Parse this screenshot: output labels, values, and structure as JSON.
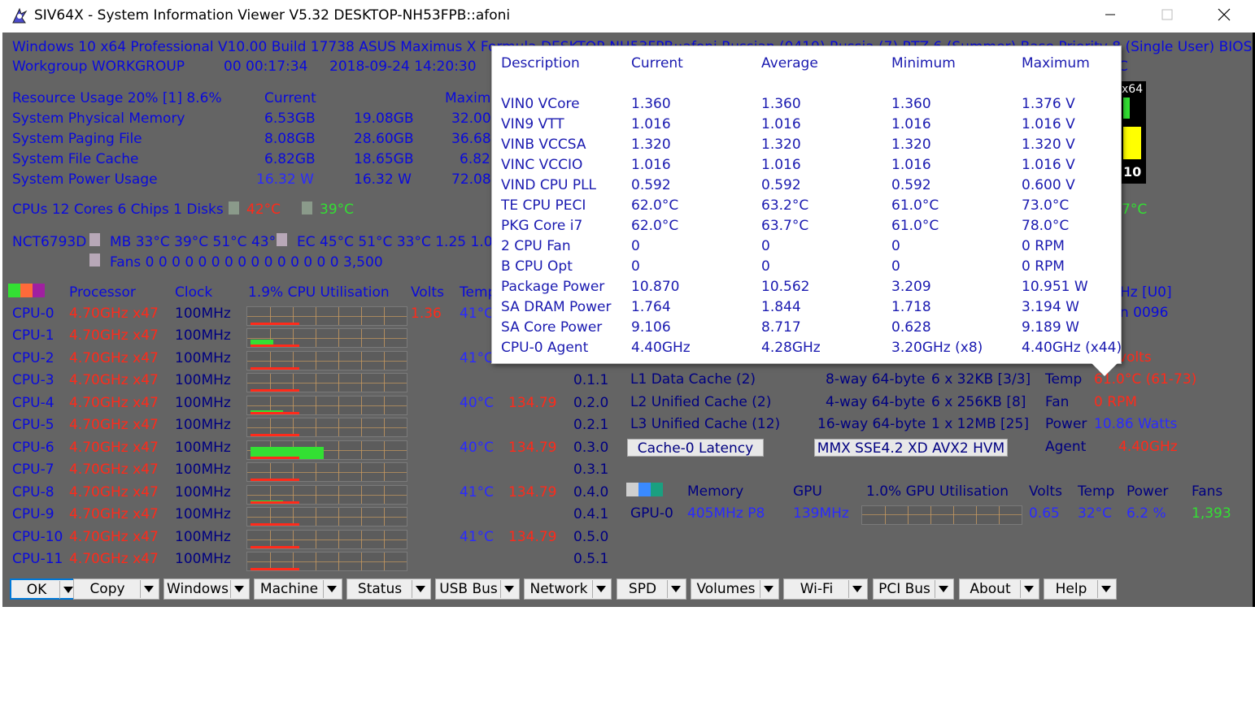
{
  "window": {
    "title": "SIV64X - System Information Viewer V5.32 DESKTOP-NH53FPB::afoni"
  },
  "header": {
    "line1": "Windows 10 x64 Professional   V10.00   Build 17738     ASUS Maximus X Formula   DESKTOP-NH53FPB::afoni   Russian (0419)   Russia (7)   RTZ 6 (Summer)   Base Priority 8 (Single User)   BIOS 160",
    "line2_a": "Workgroup WORKGROUP",
    "line2_b": "00 00:17:34",
    "line2_c": "2018-09-24 14:20:30",
    "line2_tail": "C"
  },
  "resources": {
    "title": "Resource Usage 20% [1] 8.6%",
    "col_current": "Current",
    "col_maximum": "Maximu",
    "rows": [
      {
        "label": "System Physical Memory",
        "current": "6.53GB",
        "second": "19.08GB",
        "third": "32.00"
      },
      {
        "label": "System Paging File",
        "current": "8.08GB",
        "second": "28.60GB",
        "third": "36.68"
      },
      {
        "label": "System File Cache",
        "current": "6.82GB",
        "second": "18.65GB",
        "third": "6.82"
      },
      {
        "label": "System Power Usage",
        "current": "16.32 W",
        "second": "16.32 W",
        "third": "72.08"
      }
    ]
  },
  "cpus_line": {
    "text": "CPUs 12 Cores 6 Chips 1   Disks",
    "temp1": "42°C",
    "temp2": "39°C",
    "temp_right": "7°C"
  },
  "nct": {
    "label": "NCT6793D",
    "mb": "MB 33°C 39°C 51°C 43°C",
    "ec": "EC 45°C 51°C 33°C 1.25 1.01",
    "fans": "Fans 0 0 0 0 0 0 0 0 0 0 0 0 0 0 0 3,500"
  },
  "proc_header": {
    "processor": "Processor",
    "clock": "Clock",
    "util": "1.9% CPU Utilisation",
    "volts": "Volts",
    "temp": "Temp",
    "right_a": "Hz [U0]",
    "right_b": "n 0096"
  },
  "cpus": [
    {
      "name": "CPU-0",
      "freq": "4.70GHz x47",
      "clock": "100MHz",
      "volts": "1.36",
      "temp": "41°C",
      "power": "",
      "id": ""
    },
    {
      "name": "CPU-1",
      "freq": "4.70GHz x47",
      "clock": "100MHz",
      "volts": "",
      "temp": "",
      "power": "",
      "id": ""
    },
    {
      "name": "CPU-2",
      "freq": "4.70GHz x47",
      "clock": "100MHz",
      "volts": "",
      "temp": "41°C",
      "power": "",
      "id": ""
    },
    {
      "name": "CPU-3",
      "freq": "4.70GHz x47",
      "clock": "100MHz",
      "volts": "",
      "temp": "",
      "power": "",
      "id": "0.1.1"
    },
    {
      "name": "CPU-4",
      "freq": "4.70GHz x47",
      "clock": "100MHz",
      "volts": "",
      "temp": "40°C",
      "power": "134.79",
      "id": "0.2.0"
    },
    {
      "name": "CPU-5",
      "freq": "4.70GHz x47",
      "clock": "100MHz",
      "volts": "",
      "temp": "",
      "power": "",
      "id": "0.2.1"
    },
    {
      "name": "CPU-6",
      "freq": "4.70GHz x47",
      "clock": "100MHz",
      "volts": "",
      "temp": "40°C",
      "power": "134.79",
      "id": "0.3.0"
    },
    {
      "name": "CPU-7",
      "freq": "4.70GHz x47",
      "clock": "100MHz",
      "volts": "",
      "temp": "",
      "power": "",
      "id": "0.3.1"
    },
    {
      "name": "CPU-8",
      "freq": "4.70GHz x47",
      "clock": "100MHz",
      "volts": "",
      "temp": "41°C",
      "power": "134.79",
      "id": "0.4.0"
    },
    {
      "name": "CPU-9",
      "freq": "4.70GHz x47",
      "clock": "100MHz",
      "volts": "",
      "temp": "",
      "power": "",
      "id": "0.4.1"
    },
    {
      "name": "CPU-10",
      "freq": "4.70GHz x47",
      "clock": "100MHz",
      "volts": "",
      "temp": "41°C",
      "power": "134.79",
      "id": "0.5.0"
    },
    {
      "name": "CPU-11",
      "freq": "4.70GHz x47",
      "clock": "100MHz",
      "volts": "",
      "temp": "",
      "power": "",
      "id": "0.5.1"
    }
  ],
  "cpu_graph_levels": [
    0.05,
    0.45,
    0.08,
    0.06,
    0.25,
    0.08,
    0.75,
    0.06,
    0.2,
    0.1,
    0.15,
    0.05
  ],
  "cache": [
    {
      "name": "L1 Data Cache (2)",
      "way": "8-way 64-byte",
      "size": "6 x 32KB [3/3]",
      "key": "Temp",
      "value": "61.0°C (61-73)"
    },
    {
      "name": "L2 Unified Cache (2)",
      "way": "4-way 64-byte",
      "size": "6 x 256KB [8]",
      "key": "Fan",
      "value": "0 RPM"
    },
    {
      "name": "L3 Unified Cache (12)",
      "way": "16-way 64-byte",
      "size": "1 x 12MB [25]",
      "key": "Power",
      "value": "10.86 Watts"
    }
  ],
  "volts_tail": "volts",
  "cache_latency_button": "Cache-0 Latency",
  "features_button": "MMX SSE4.2 XD AVX2 HVM",
  "agent": {
    "key": "Agent",
    "value": "4.40GHz"
  },
  "gpu_header": {
    "memory": "Memory",
    "gpu": "GPU",
    "util": "1.0% GPU Utilisation",
    "volts": "Volts",
    "temp": "Temp",
    "power": "Power",
    "fans": "Fans"
  },
  "gpu": {
    "name": "GPU-0",
    "memory": "405MHz P8",
    "clock": "139MHz",
    "volts": "0.65",
    "temp": "32°C",
    "power": "6.2 %",
    "fans": "1,393"
  },
  "side_badge": {
    "top": "x64",
    "bottom": "10"
  },
  "popup": {
    "headers": [
      "Description",
      "Current",
      "Average",
      "Minimum",
      "Maximum"
    ],
    "rows": [
      [
        "VIN0 VCore",
        "1.360",
        "1.360",
        "1.360",
        "1.376 V"
      ],
      [
        "VIN9 VTT",
        "1.016",
        "1.016",
        "1.016",
        "1.016 V"
      ],
      [
        "VINB VCCSA",
        "1.320",
        "1.320",
        "1.320",
        "1.320 V"
      ],
      [
        "VINC VCCIO",
        "1.016",
        "1.016",
        "1.016",
        "1.016 V"
      ],
      [
        "VIND CPU PLL",
        "0.592",
        "0.592",
        "0.592",
        "0.600 V"
      ],
      [
        "TE CPU PECI",
        "62.0°C",
        "63.2°C",
        "61.0°C",
        "73.0°C"
      ],
      [
        "PKG Core i7",
        "62.0°C",
        "63.7°C",
        "61.0°C",
        "78.0°C"
      ],
      [
        "2 CPU Fan",
        "0",
        "0",
        "0",
        "0 RPM"
      ],
      [
        "B CPU Opt",
        "0",
        "0",
        "0",
        "0 RPM"
      ],
      [
        "Package Power",
        "10.870",
        "10.562",
        "3.209",
        "10.951 W"
      ],
      [
        "SA DRAM Power",
        "1.764",
        "1.844",
        "1.718",
        "3.194 W"
      ],
      [
        "SA Core Power",
        "9.106",
        "8.717",
        "0.628",
        "9.189 W"
      ],
      [
        "CPU-0  Agent",
        "4.40GHz",
        "4.28GHz",
        "3.20GHz (x8)",
        "4.40GHz (x44)"
      ]
    ]
  },
  "buttons": [
    "OK",
    "Copy",
    "Windows",
    "Machine",
    "Status",
    "USB Bus",
    "Network",
    "SPD",
    "Volumes",
    "Wi-Fi",
    "PCI Bus",
    "About",
    "Help"
  ],
  "colors": {
    "panel": "#646464",
    "navy": "#0a0adc",
    "red": "#ff2a1a",
    "green": "#33e033",
    "popup_text": "#1a1ab0"
  }
}
